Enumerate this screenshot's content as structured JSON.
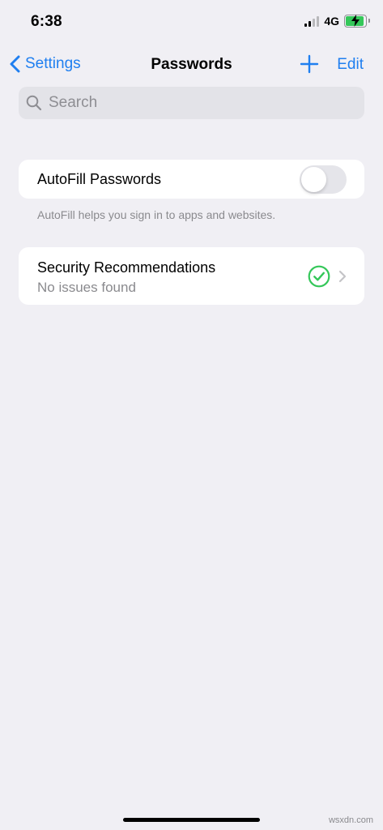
{
  "status_bar": {
    "time": "6:38",
    "network": "4G",
    "battery_color": "#34c759"
  },
  "nav": {
    "back_label": "Settings",
    "title": "Passwords",
    "add_icon": "plus-icon",
    "edit_label": "Edit",
    "accent_color": "#1f7ff0"
  },
  "search": {
    "placeholder": "Search",
    "value": ""
  },
  "autofill": {
    "label": "AutoFill Passwords",
    "enabled": false,
    "footnote": "AutoFill helps you sign in to apps and websites."
  },
  "security": {
    "title": "Security Recommendations",
    "subtitle": "No issues found",
    "status_icon": "checkmark-circle-icon",
    "status_color": "#34c759"
  },
  "watermark": "wsxdn.com"
}
